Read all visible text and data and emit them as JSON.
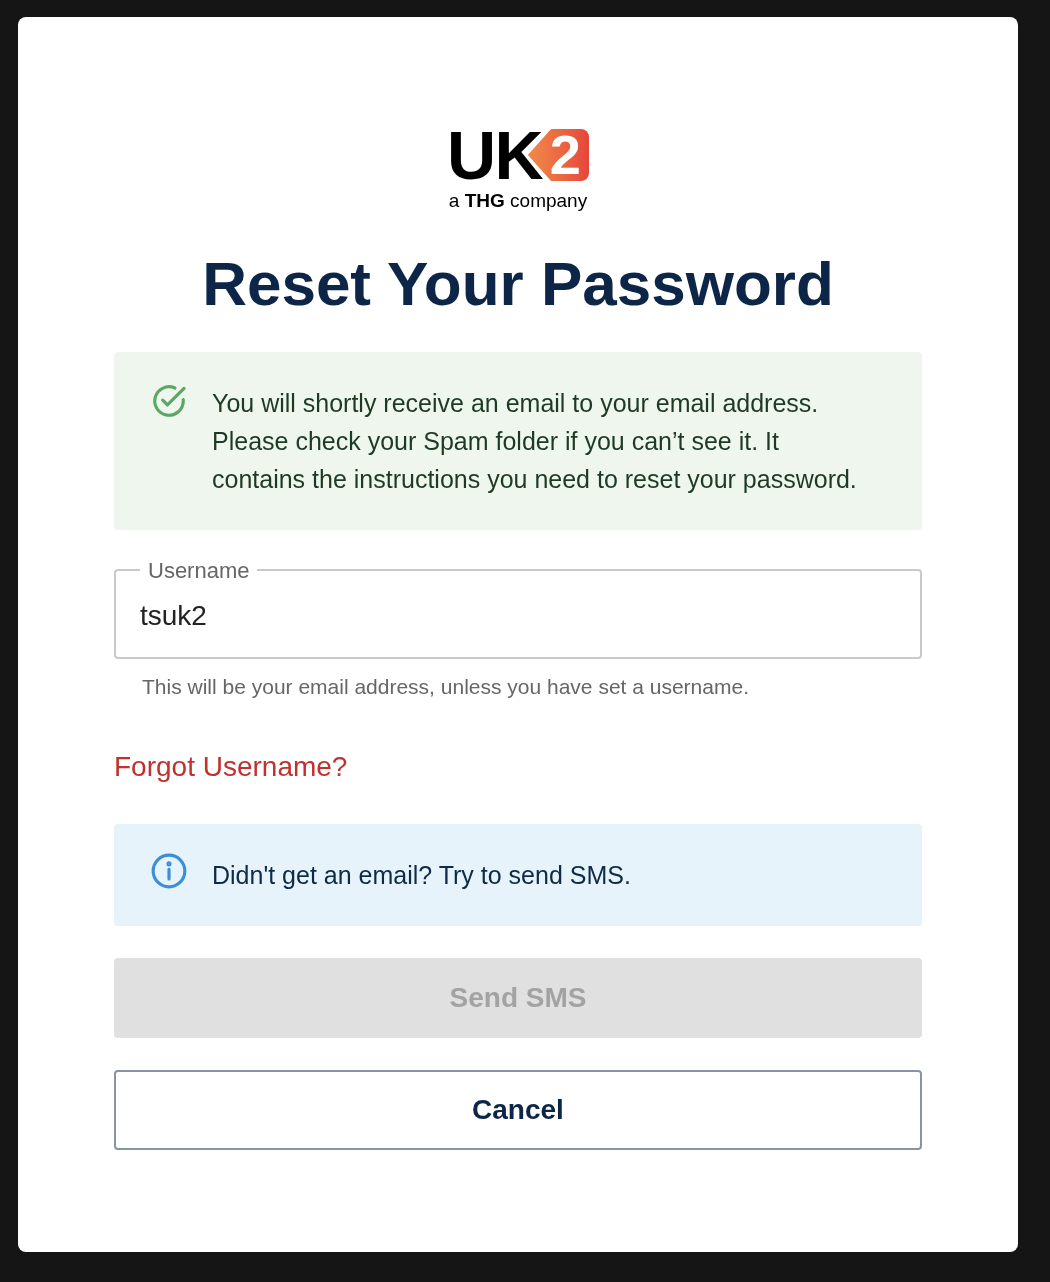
{
  "logo": {
    "wordmark": "UK",
    "badge": "2",
    "tagline": "a **THG** company"
  },
  "title": "Reset Your Password",
  "alerts": [
    {
      "kind": "success",
      "text": "You will shortly receive an email to your email address. Please check your Spam folder if you can’t see it. It contains the instructions you need to reset your password."
    },
    {
      "kind": "info",
      "text": "Didn't get an email? Try to send SMS."
    }
  ],
  "username": {
    "label": "Username",
    "value": "tsuk2",
    "helper": "This will be your email address, unless you have set a username."
  },
  "forgot_link": "Forgot Username?",
  "buttons": [
    {
      "kind": "primary",
      "label": "Send SMS",
      "disabled": true
    },
    {
      "kind": "outline",
      "label": "Cancel",
      "disabled": false
    }
  ]
}
